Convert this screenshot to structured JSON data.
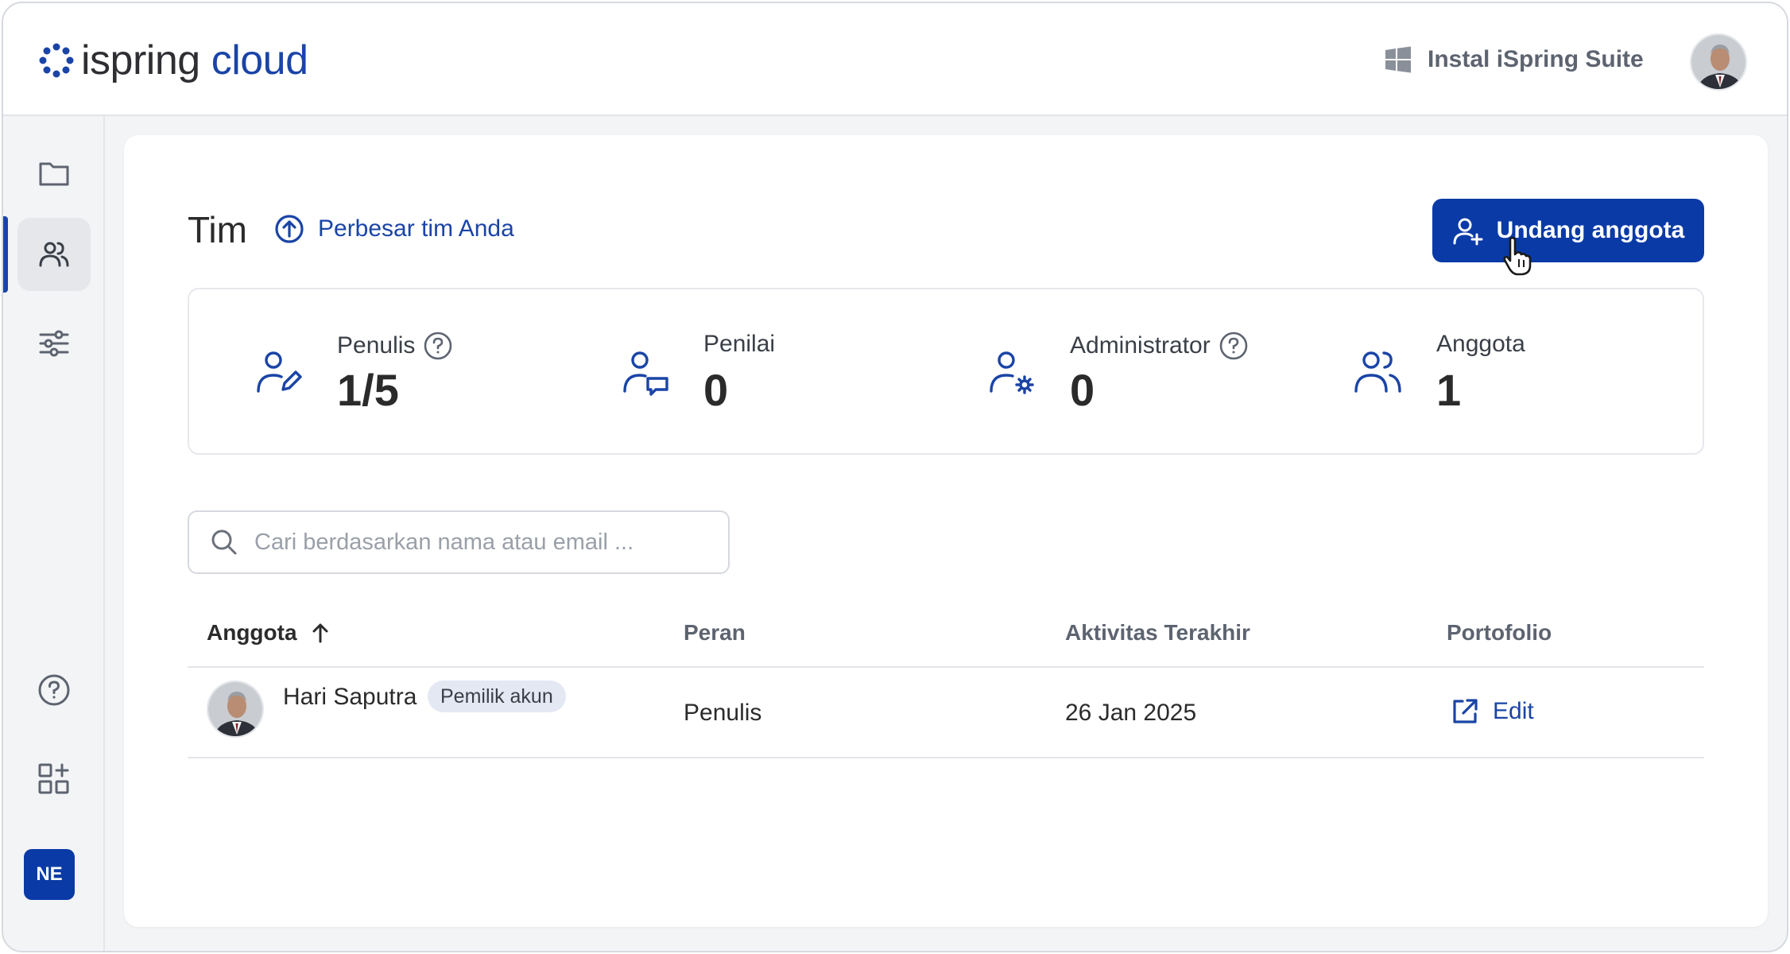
{
  "header": {
    "logo_word1": "ispring",
    "logo_word2": "cloud",
    "install_label": "Instal iSpring Suite"
  },
  "sidebar": {
    "items": [
      {
        "name": "folder-icon"
      },
      {
        "name": "users-icon",
        "active": true
      },
      {
        "name": "sliders-icon"
      },
      {
        "name": "help-icon"
      },
      {
        "name": "apps-add-icon"
      }
    ],
    "account_initials": "NE"
  },
  "main": {
    "title": "Tim",
    "grow_link": "Perbesar tim Anda",
    "invite_button": "Undang anggota",
    "stats": [
      {
        "label": "Penulis",
        "value": "1/5",
        "has_help": true
      },
      {
        "label": "Penilai",
        "value": "0",
        "has_help": false
      },
      {
        "label": "Administrator",
        "value": "0",
        "has_help": true
      },
      {
        "label": "Anggota",
        "value": "1",
        "has_help": false
      }
    ],
    "search": {
      "placeholder": "Cari berdasarkan nama atau email ..."
    },
    "table": {
      "columns": [
        "Anggota",
        "Peran",
        "Aktivitas Terakhir",
        "Portofolio"
      ],
      "rows": [
        {
          "name": "Hari Saputra",
          "badge": "Pemilik akun",
          "role": "Penulis",
          "last_activity": "26 Jan 2025",
          "portfolio_action": "Edit"
        }
      ]
    }
  },
  "colors": {
    "accent": "#0a3aa6",
    "link": "#1a44a6",
    "badge_bg": "#e3e8f3"
  }
}
